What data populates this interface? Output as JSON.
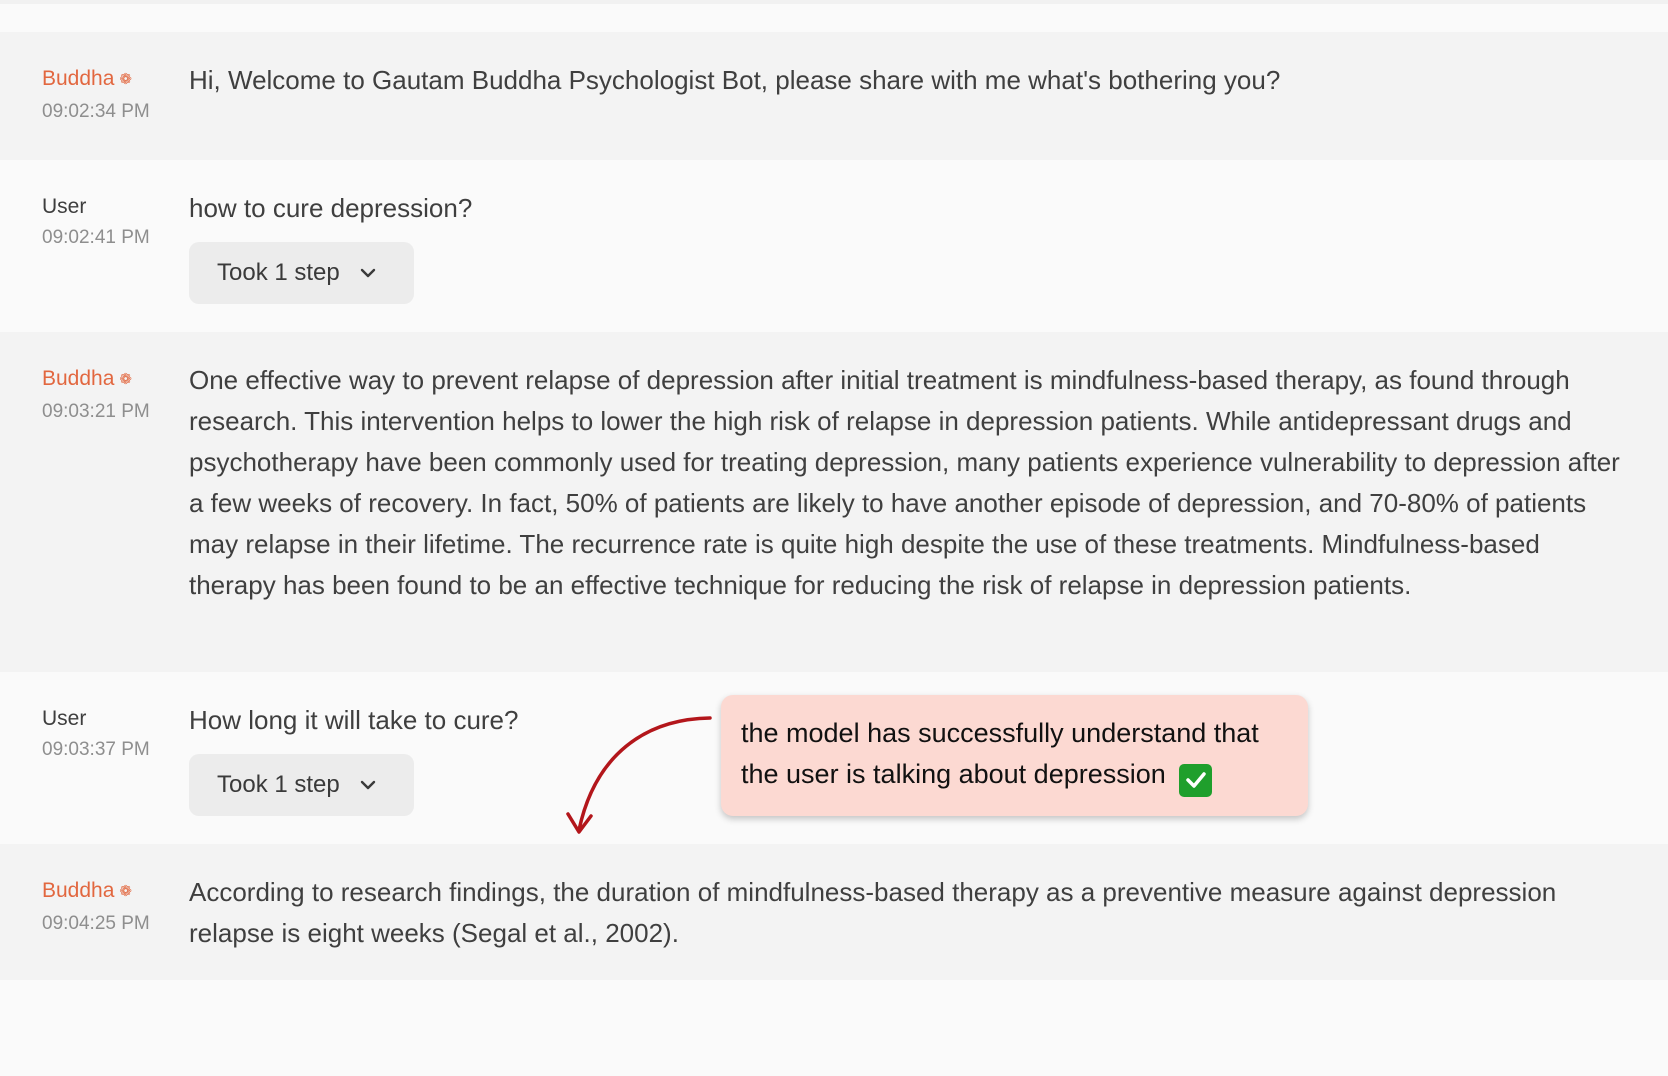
{
  "messages": [
    {
      "author": "Buddha",
      "time": "09:02:34 PM",
      "text": "Hi, Welcome to Gautam Buddha Psychologist Bot, please share with me what's bothering you?"
    },
    {
      "author": "User",
      "time": "09:02:41 PM",
      "text": "how to cure depression?",
      "step_label": "Took 1 step"
    },
    {
      "author": "Buddha",
      "time": "09:03:21 PM",
      "text": "One effective way to prevent relapse of depression after initial treatment is mindfulness-based therapy, as found through research. This intervention helps to lower the high risk of relapse in depression patients. While antidepressant drugs and psychotherapy have been commonly used for treating depression, many patients experience vulnerability to depression after a few weeks of recovery. In fact, 50% of patients are likely to have another episode of depression, and 70-80% of patients may relapse in their lifetime. The recurrence rate is quite high despite the use of these treatments. Mindfulness-based therapy has been found to be an effective technique for reducing the risk of relapse in depression patients."
    },
    {
      "author": "User",
      "time": "09:03:37 PM",
      "text": "How long it will take to cure?",
      "step_label": "Took 1 step"
    },
    {
      "author": "Buddha",
      "time": "09:04:25 PM",
      "text": "According to research findings, the duration of mindfulness-based therapy as a preventive measure against depression relapse is eight weeks (Segal et al., 2002)."
    }
  ],
  "annotation": {
    "text": "the model has successfully understand that the user is talking about depression",
    "check_icon": "white-check-mark-icon"
  },
  "colors": {
    "bot_author": "#e2673f",
    "callout_bg": "#fcd9d2",
    "arrow": "#b3161b",
    "check_bg": "#1f9f2c"
  }
}
